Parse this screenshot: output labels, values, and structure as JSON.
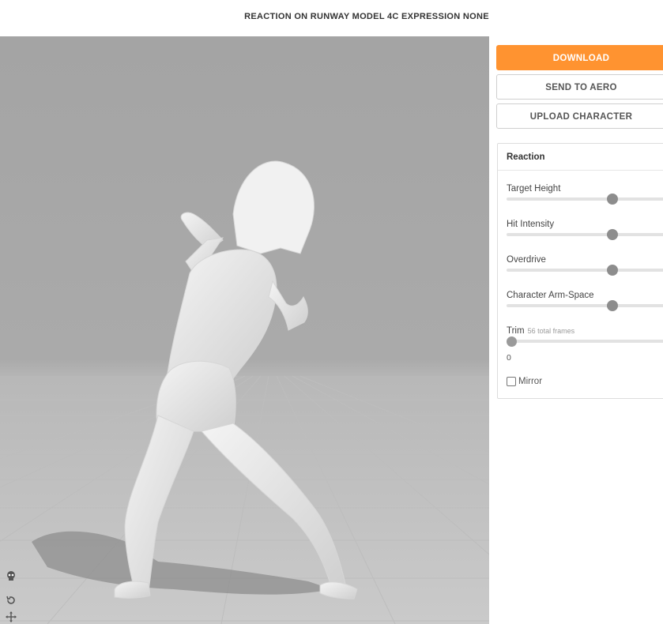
{
  "header": {
    "title": "REACTION ON RUNWAY MODEL 4C EXPRESSION NONE"
  },
  "viewport": {
    "icons": [
      {
        "name": "skeleton-icon",
        "glyph": "💀"
      },
      {
        "name": "reset-camera-icon",
        "glyph": "⟲"
      },
      {
        "name": "pan-move-icon",
        "glyph": "✥"
      }
    ]
  },
  "actions": {
    "download_label": "DOWNLOAD",
    "send_label": "SEND TO AERO",
    "upload_label": "UPLOAD CHARACTER"
  },
  "settings": {
    "heading": "Reaction",
    "sliders": [
      {
        "label": "Target Height",
        "value": 0.67
      },
      {
        "label": "Hit Intensity",
        "value": 0.67
      },
      {
        "label": "Overdrive",
        "value": 0.67
      },
      {
        "label": "Character Arm-Space",
        "value": 0.67
      }
    ],
    "trim": {
      "label": "Trim",
      "sub_label": "56 total frames",
      "value": "0",
      "position": 0
    },
    "mirror": {
      "label": "Mirror",
      "checked": false
    }
  },
  "colors": {
    "accent": "#ff9330",
    "thumb": "#8d8d8d",
    "track": "#e2e2e2"
  }
}
